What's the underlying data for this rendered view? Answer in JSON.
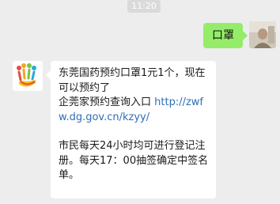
{
  "status": {
    "time": "11:20"
  },
  "chat": {
    "user_message": {
      "text": "口罩"
    },
    "bot_reply": {
      "line1": "东莞国药预约口罩1元1个，现在可以预约了",
      "line2_prefix": "企莞家预约查询入口 ",
      "link_text": "http://zwfw.dg.gov.cn/kzyy/",
      "line3": "市民每天24小时均可进行登记注册。每天17：00抽签确定中签名单。"
    }
  },
  "icons": {
    "user_avatar": "user-avatar-photo",
    "bot_avatar": "hand-logo-icon"
  },
  "colors": {
    "background": "#ededed",
    "user_bubble": "#95ec69",
    "bot_bubble": "#ffffff",
    "link": "#2f6fb8"
  }
}
